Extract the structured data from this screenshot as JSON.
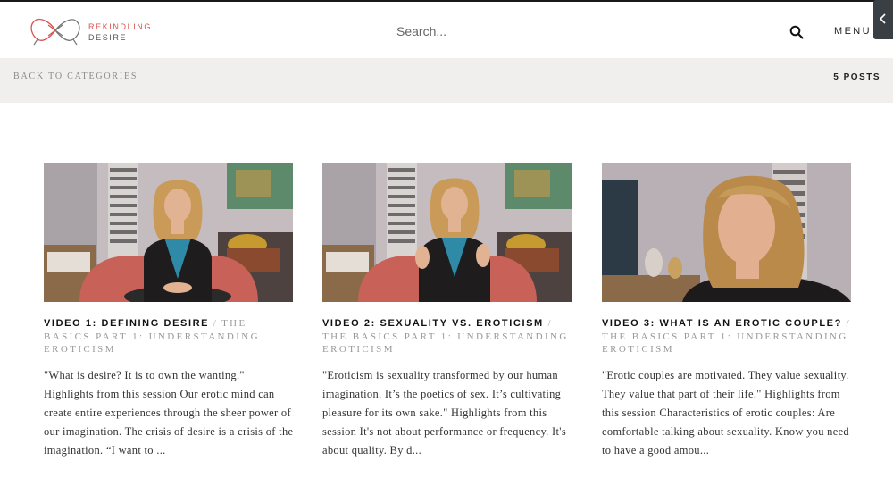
{
  "brand": {
    "line1": "REKINDLING",
    "line2": "DESIRE",
    "accent": "#d9534f"
  },
  "header": {
    "search_placeholder": "Search...",
    "menu_label": "MENU"
  },
  "subbar": {
    "back_label": "BACK TO CATEGORIES",
    "posts_count": "5 POSTS"
  },
  "posts": [
    {
      "title": "VIDEO 1: DEFINING DESIRE",
      "separator": "/",
      "category": "THE BASICS PART 1: UNDERSTANDING EROTICISM",
      "excerpt": "\"What is desire? It is to own the wanting.\"  Highlights from this session Our erotic mind can create entire experiences through the sheer power of our imagination. The crisis of desire is a crisis of the imagination. “I want to ..."
    },
    {
      "title": "VIDEO 2: SEXUALITY VS. EROTICISM",
      "separator": "/",
      "category": "THE BASICS PART 1: UNDERSTANDING EROTICISM",
      "excerpt": "\"Eroticism is sexuality transformed by our human imagination. It’s the poetics of sex. It’s cultivating pleasure for its own sake.\" Highlights from this session It's not about performance or frequency. It's about quality. By d..."
    },
    {
      "title": "VIDEO 3: WHAT IS AN EROTIC COUPLE?",
      "separator": "/",
      "category": "THE BASICS PART 1: UNDERSTANDING EROTICISM",
      "excerpt": "\"Erotic couples are motivated. They value sexuality. They value that part of their life.\" Highlights from this session Characteristics of erotic couples: Are comfortable talking about sexuality. Know you need to have a good amou..."
    }
  ]
}
